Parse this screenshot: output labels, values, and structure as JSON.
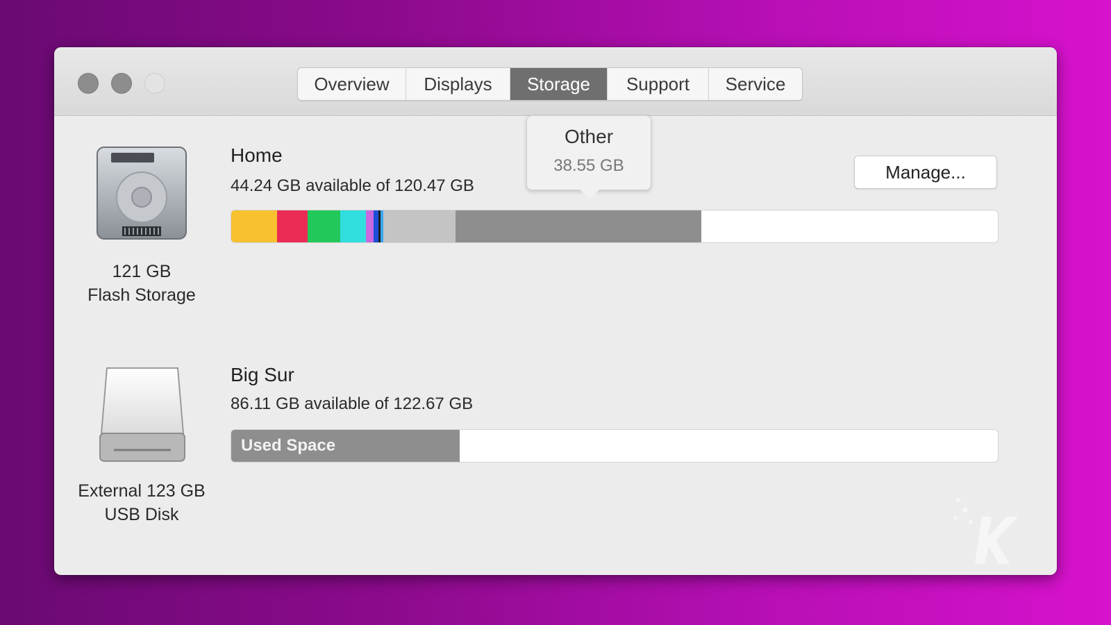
{
  "window": {
    "tabs": [
      {
        "label": "Overview",
        "active": false
      },
      {
        "label": "Displays",
        "active": false
      },
      {
        "label": "Storage",
        "active": true
      },
      {
        "label": "Support",
        "active": false
      },
      {
        "label": "Service",
        "active": false
      }
    ]
  },
  "disks": [
    {
      "icon": "internal-drive-icon",
      "caption_line1": "121 GB",
      "caption_line2": "Flash Storage",
      "volume_name": "Home",
      "volume_summary": "44.24 GB available of 120.47 GB",
      "manage_label": "Manage...",
      "segments": [
        {
          "color": "#f7c130",
          "fraction": 0.06
        },
        {
          "color": "#ea2c55",
          "fraction": 0.04
        },
        {
          "color": "#22c85a",
          "fraction": 0.042
        },
        {
          "color": "#30dede",
          "fraction": 0.034
        },
        {
          "color": "#c869e0",
          "fraction": 0.01
        },
        {
          "color": "#1e4dd8",
          "fraction": 0.006
        },
        {
          "color": "#1e1e1e",
          "fraction": 0.003
        },
        {
          "color": "#3ba6f0",
          "fraction": 0.003
        },
        {
          "color": "#c4c4c4",
          "fraction": 0.095
        },
        {
          "color": "#8e8e8e",
          "fraction": 0.32
        }
      ],
      "tooltip": {
        "title": "Other",
        "value": "38.55 GB"
      }
    },
    {
      "icon": "external-drive-icon",
      "caption_line1": "External 123 GB",
      "caption_line2": "USB Disk",
      "volume_name": "Big Sur",
      "volume_summary": "86.11 GB available of 122.67 GB",
      "used_label": "Used Space",
      "used_fraction": 0.298,
      "used_color": "#8e8e8e"
    }
  ],
  "watermark": {
    "letter": "K"
  }
}
